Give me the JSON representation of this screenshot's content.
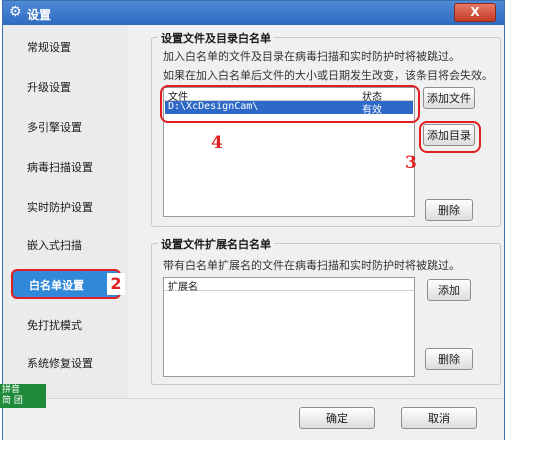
{
  "window": {
    "title": "设置",
    "close_label": "X"
  },
  "sidebar": {
    "items": [
      {
        "label": "常规设置"
      },
      {
        "label": "升级设置"
      },
      {
        "label": "多引擎设置"
      },
      {
        "label": "病毒扫描设置"
      },
      {
        "label": "实时防护设置"
      },
      {
        "label": "嵌入式扫描"
      },
      {
        "label": "白名单设置",
        "active": true,
        "badge": "2"
      },
      {
        "label": "免打扰模式"
      },
      {
        "label": "系统修复设置"
      }
    ]
  },
  "file_whitelist": {
    "title": "设置文件及目录白名单",
    "desc1": "加入白名单的文件及目录在病毒扫描和实时防护时将被跳过。",
    "desc2": "如果在加入白名单后文件的大小或日期发生改变，该条目将会失效。",
    "columns": [
      "文件",
      "状态"
    ],
    "rows": [
      {
        "file": "D:\\XcDesignCam\\",
        "status": "有效"
      }
    ],
    "add_file_label": "添加文件",
    "add_dir_label": "添加目录",
    "delete_label": "删除"
  },
  "ext_whitelist": {
    "title": "设置文件扩展名白名单",
    "desc": "带有白名单扩展名的文件在病毒扫描和实时防护时将被跳过。",
    "column": "扩展名",
    "add_label": "添加",
    "delete_label": "删除"
  },
  "annotations": {
    "list_num": "4",
    "button_num": "3"
  },
  "footer": {
    "ok_label": "确定",
    "cancel_label": "取消"
  },
  "ime": {
    "line1": "拼音",
    "line2": "简 团"
  },
  "colors": {
    "accent": "#2f89d8",
    "annotation": "#e02020",
    "selection": "#2f69c8"
  }
}
